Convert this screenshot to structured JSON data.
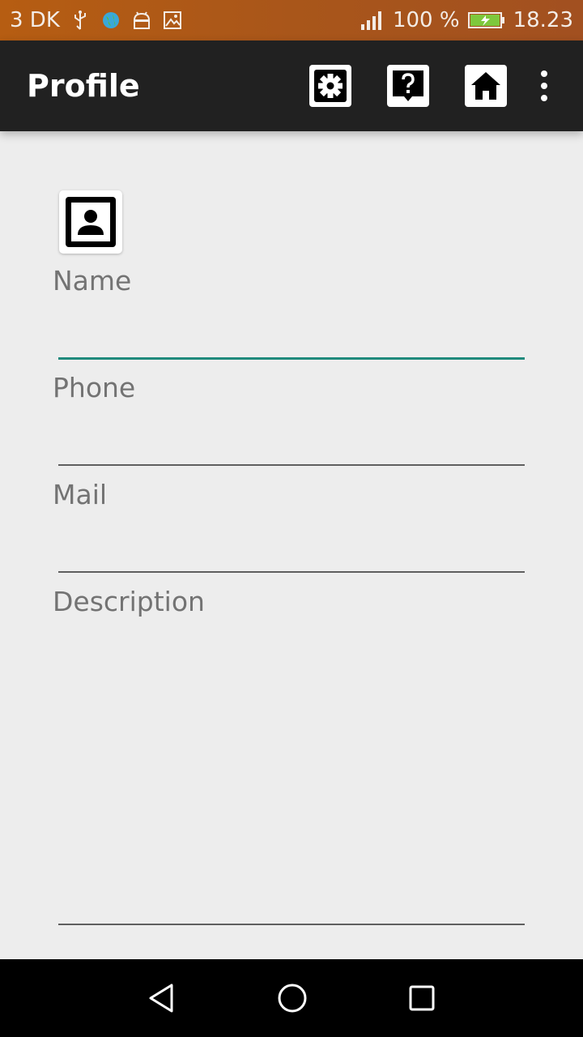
{
  "status_bar": {
    "carrier": "3 DK",
    "battery": "100 %",
    "time": "18.23",
    "icons": [
      "usb-icon",
      "globe-icon",
      "android-icon",
      "image-icon",
      "signal-icon",
      "battery-charging-icon"
    ]
  },
  "toolbar": {
    "title": "Profile",
    "actions": [
      "settings-icon",
      "help-icon",
      "home-icon",
      "overflow-menu-icon"
    ]
  },
  "profile": {
    "avatar_icon": "contact-card-icon",
    "fields": {
      "name": {
        "label": "Name",
        "value": ""
      },
      "phone": {
        "label": "Phone",
        "value": ""
      },
      "mail": {
        "label": "Mail",
        "value": ""
      },
      "description": {
        "label": "Description",
        "value": ""
      }
    }
  },
  "nav_bar": {
    "buttons": [
      "back-icon",
      "home-circle-icon",
      "recents-icon"
    ]
  },
  "colors": {
    "status_bar": "#b65d12",
    "toolbar": "#212121",
    "background": "#ededed",
    "accent": "#1f8a7c",
    "label": "#737373"
  }
}
